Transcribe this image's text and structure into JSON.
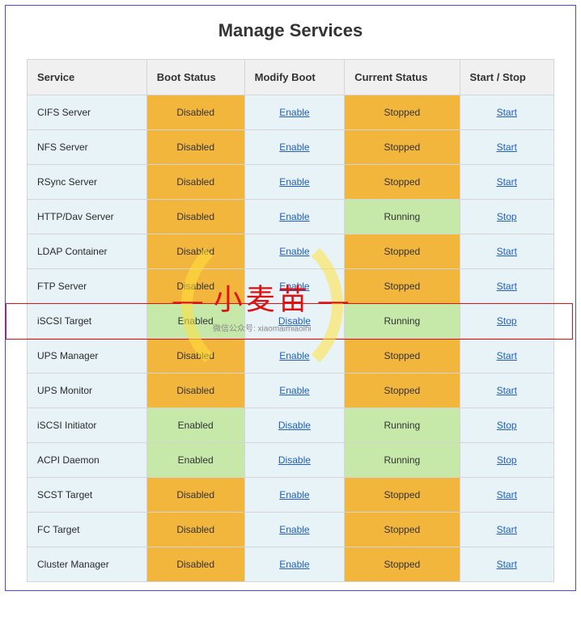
{
  "title": "Manage Services",
  "columns": [
    "Service",
    "Boot Status",
    "Modify Boot",
    "Current Status",
    "Start / Stop"
  ],
  "services": [
    {
      "name": "CIFS Server",
      "boot_status": "Disabled",
      "modify_boot": "Enable",
      "current_status": "Stopped",
      "start_stop": "Start"
    },
    {
      "name": "NFS Server",
      "boot_status": "Disabled",
      "modify_boot": "Enable",
      "current_status": "Stopped",
      "start_stop": "Start"
    },
    {
      "name": "RSync Server",
      "boot_status": "Disabled",
      "modify_boot": "Enable",
      "current_status": "Stopped",
      "start_stop": "Start"
    },
    {
      "name": "HTTP/Dav Server",
      "boot_status": "Disabled",
      "modify_boot": "Enable",
      "current_status": "Running",
      "start_stop": "Stop"
    },
    {
      "name": "LDAP Container",
      "boot_status": "Disabled",
      "modify_boot": "Enable",
      "current_status": "Stopped",
      "start_stop": "Start"
    },
    {
      "name": "FTP Server",
      "boot_status": "Disabled",
      "modify_boot": "Enable",
      "current_status": "Stopped",
      "start_stop": "Start"
    },
    {
      "name": "iSCSI Target",
      "boot_status": "Enabled",
      "modify_boot": "Disable",
      "current_status": "Running",
      "start_stop": "Stop"
    },
    {
      "name": "UPS Manager",
      "boot_status": "Disabled",
      "modify_boot": "Enable",
      "current_status": "Stopped",
      "start_stop": "Start"
    },
    {
      "name": "UPS Monitor",
      "boot_status": "Disabled",
      "modify_boot": "Enable",
      "current_status": "Stopped",
      "start_stop": "Start"
    },
    {
      "name": "iSCSI Initiator",
      "boot_status": "Enabled",
      "modify_boot": "Disable",
      "current_status": "Running",
      "start_stop": "Stop"
    },
    {
      "name": "ACPI Daemon",
      "boot_status": "Enabled",
      "modify_boot": "Disable",
      "current_status": "Running",
      "start_stop": "Stop"
    },
    {
      "name": "SCST Target",
      "boot_status": "Disabled",
      "modify_boot": "Enable",
      "current_status": "Stopped",
      "start_stop": "Start"
    },
    {
      "name": "FC Target",
      "boot_status": "Disabled",
      "modify_boot": "Enable",
      "current_status": "Stopped",
      "start_stop": "Start"
    },
    {
      "name": "Cluster Manager",
      "boot_status": "Disabled",
      "modify_boot": "Enable",
      "current_status": "Stopped",
      "start_stop": "Start"
    }
  ],
  "highlighted_row_index": 6,
  "watermark": {
    "main": "小麦苗",
    "sub": "微信公众号: xiaomaimiaolhi"
  },
  "colors": {
    "disabled_bg": "#f3b63c",
    "enabled_bg": "#c6e8a8",
    "stopped_bg": "#f3b63c",
    "running_bg": "#c6e8a8",
    "link": "#2060c0",
    "highlight_border": "#d11"
  }
}
